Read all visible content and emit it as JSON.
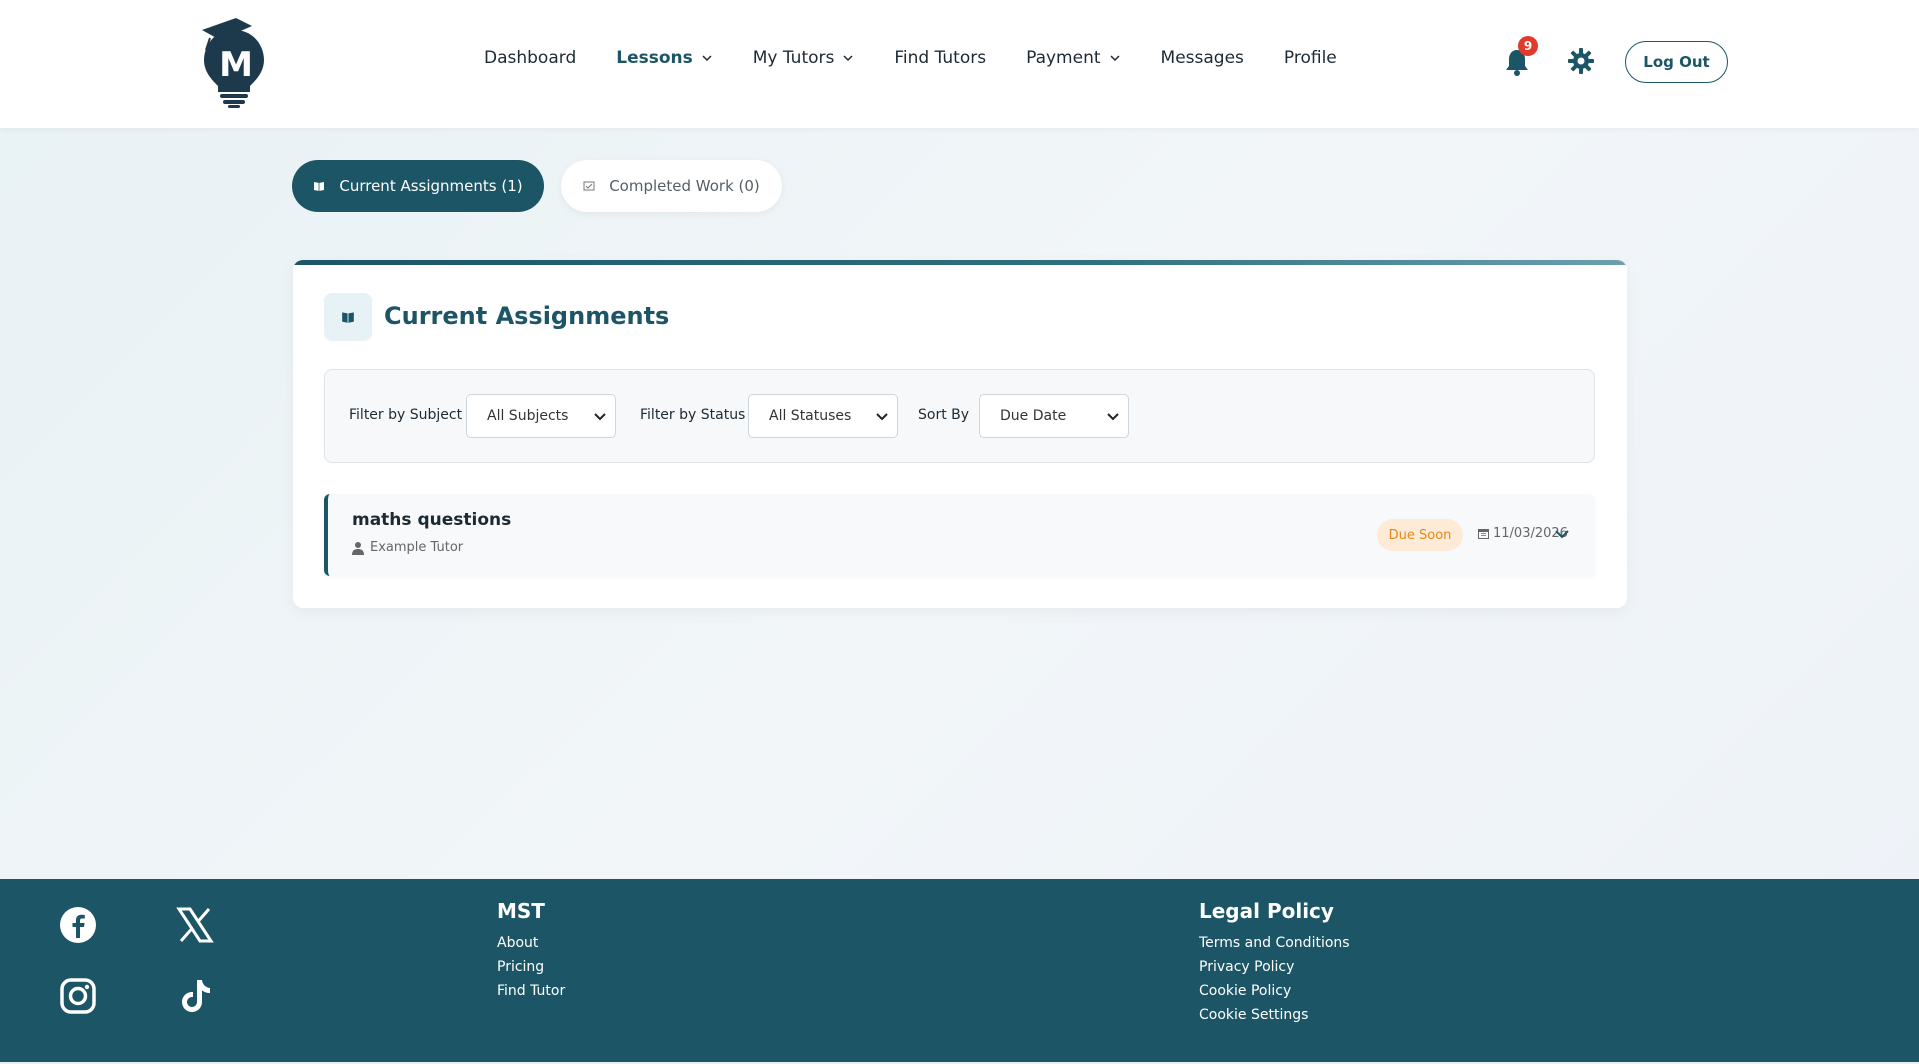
{
  "header": {
    "nav": [
      {
        "label": "Dashboard",
        "has_dropdown": false,
        "active": false
      },
      {
        "label": "Lessons",
        "has_dropdown": true,
        "active": true
      },
      {
        "label": "My Tutors",
        "has_dropdown": true,
        "active": false
      },
      {
        "label": "Find Tutors",
        "has_dropdown": false,
        "active": false
      },
      {
        "label": "Payment",
        "has_dropdown": true,
        "active": false
      },
      {
        "label": "Messages",
        "has_dropdown": false,
        "active": false
      },
      {
        "label": "Profile",
        "has_dropdown": false,
        "active": false
      }
    ],
    "notification_count": "9",
    "logout_label": "Log Out",
    "logo_letter": "M"
  },
  "tabs": {
    "current": "Current Assignments (1)",
    "completed": "Completed Work (0)"
  },
  "card": {
    "title": "Current Assignments",
    "filters": {
      "subject_label": "Filter by Subject",
      "subject_value": "All Subjects",
      "status_label": "Filter by Status",
      "status_value": "All Statuses",
      "sort_label": "Sort By",
      "sort_value": "Due Date"
    },
    "assignments": [
      {
        "title": "maths questions",
        "tutor": "Example Tutor",
        "status": "Due Soon",
        "due_date": "11/03/2026"
      }
    ]
  },
  "footer": {
    "mst": {
      "title": "MST",
      "links": [
        "About",
        "Pricing",
        "Find Tutor"
      ]
    },
    "legal": {
      "title": "Legal Policy",
      "links": [
        "Terms and Conditions",
        "Privacy Policy",
        "Cookie Policy",
        "Cookie Settings"
      ]
    },
    "social": [
      "facebook-icon",
      "x-icon",
      "instagram-icon",
      "tiktok-icon"
    ]
  },
  "colors": {
    "primary": "#1c5566",
    "due_soon_text": "#e48a16",
    "due_soon_bg": "#fdebd7",
    "badge": "#e03b2d"
  }
}
